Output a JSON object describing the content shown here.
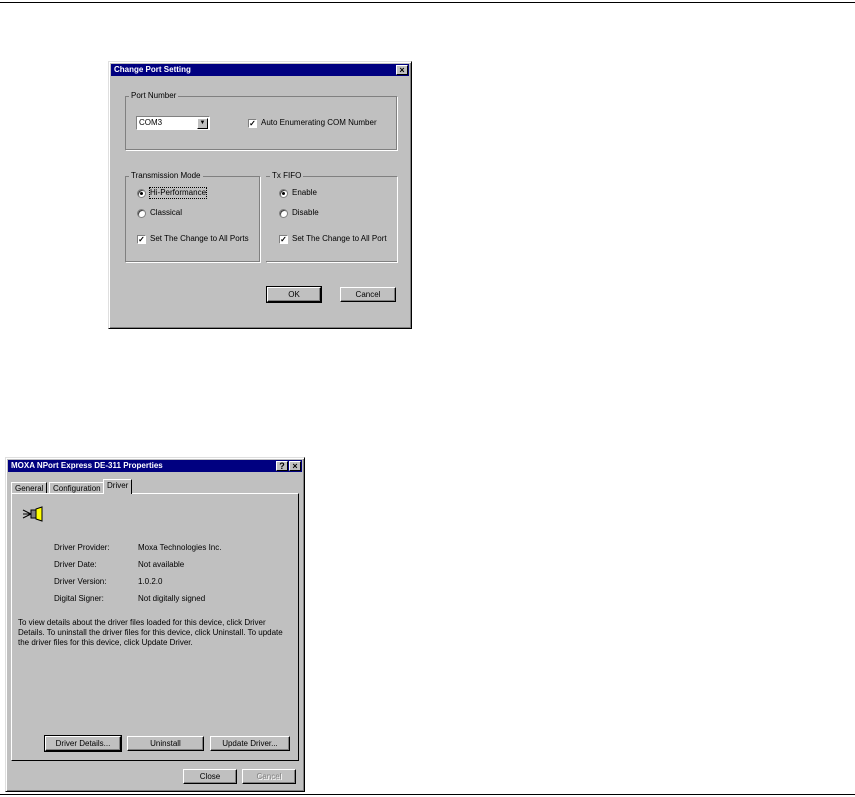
{
  "dialog1": {
    "title": "Change Port Setting",
    "close_glyph": "×",
    "port_group": "Port Number",
    "port_value": "COM3",
    "auto_enum": "Auto Enumerating COM Number",
    "mode_group": "Transmission Mode",
    "hi_perf": "Hi-Performance",
    "classical": "Classical",
    "set_all_ports_mode": "Set The Change to All Ports",
    "fifo_group": "Tx FIFO",
    "enable": "Enable",
    "disable": "Disable",
    "set_all_ports_fifo": "Set The Change to All Port",
    "ok": "OK",
    "cancel": "Cancel"
  },
  "dialog2": {
    "title": "MOXA NPort Express DE-311 Properties",
    "help_glyph": "?",
    "close_glyph": "×",
    "tabs": [
      "General",
      "Configuration",
      "Driver"
    ],
    "fields": [
      {
        "label": "Driver Provider:",
        "value": "Moxa Technologies Inc."
      },
      {
        "label": "Driver Date:",
        "value": "Not available"
      },
      {
        "label": "Driver Version:",
        "value": "1.0.2.0"
      },
      {
        "label": "Digital Signer:",
        "value": "Not digitally signed"
      }
    ],
    "description": "To view details about the driver files loaded for this device, click Driver Details. To uninstall the driver files for this device, click Uninstall. To update the driver files for this device, click Update Driver.",
    "driver_details": "Driver Details...",
    "uninstall": "Uninstall",
    "update_driver": "Update Driver...",
    "close": "Close",
    "cancel": "Cancel"
  }
}
